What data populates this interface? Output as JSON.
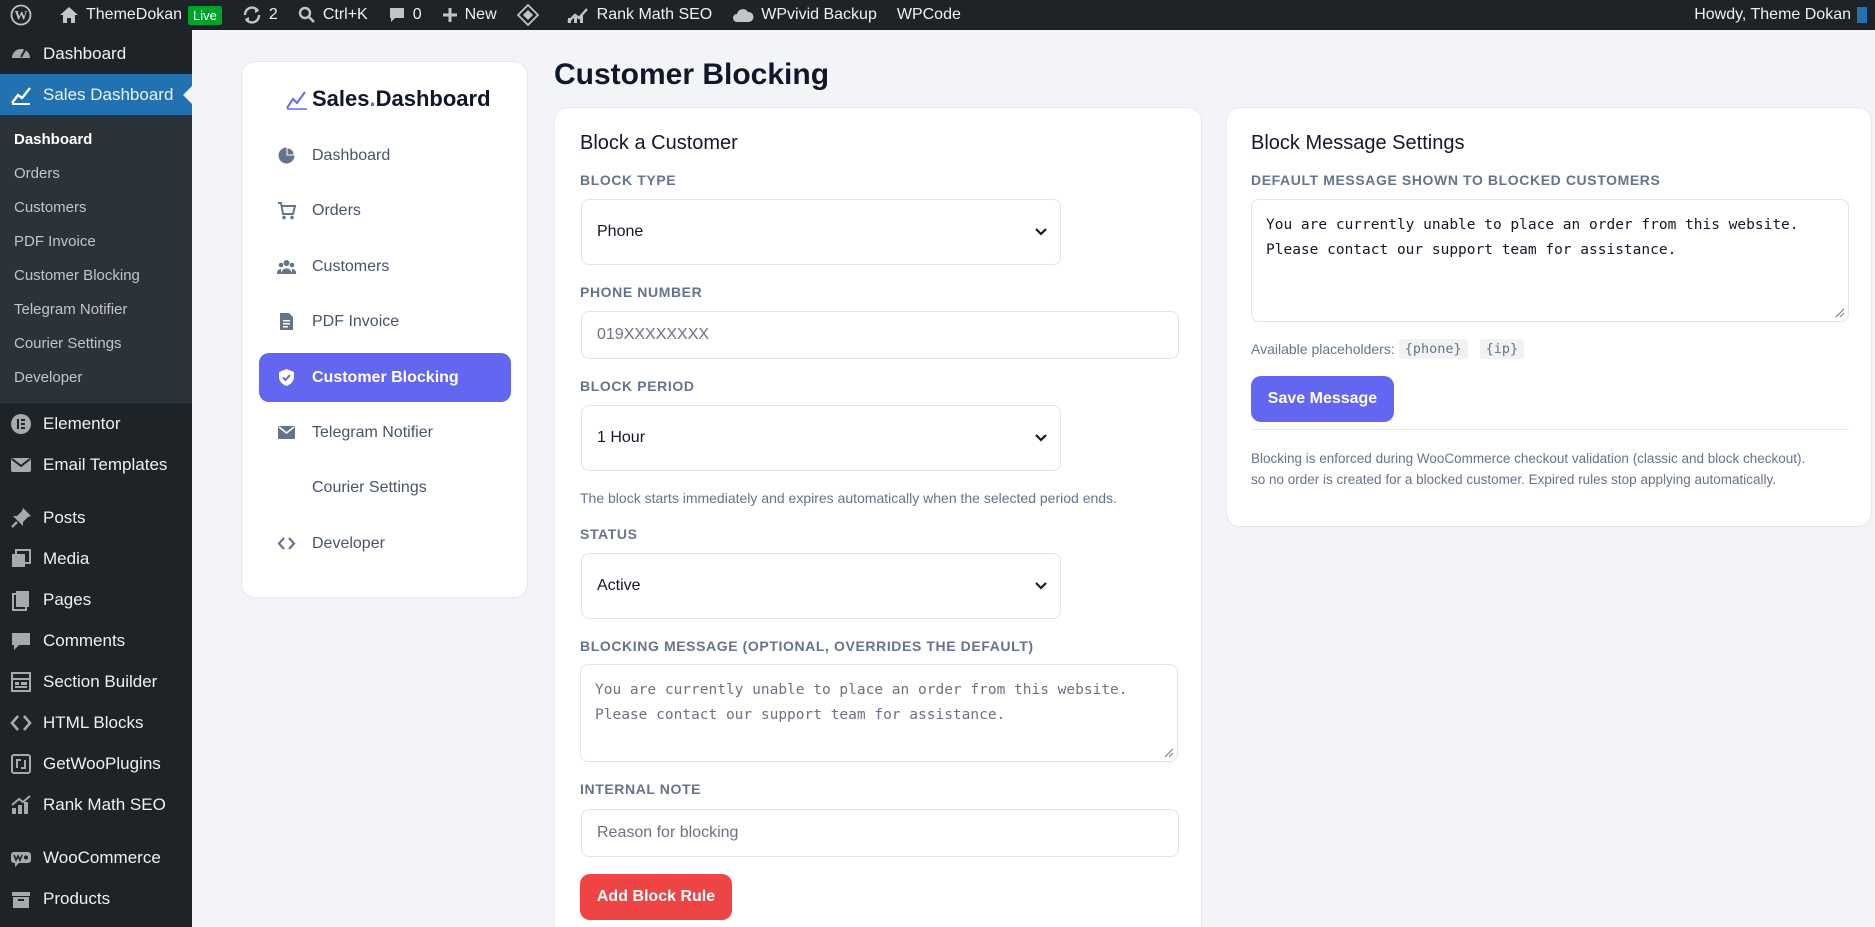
{
  "adminbar": {
    "site_name": "ThemeDokan",
    "live_badge": "Live",
    "updates_count": "2",
    "search_shortcut": "Ctrl+K",
    "comments_count": "0",
    "new_label": "New",
    "rank_math": "Rank Math SEO",
    "wpvivid": "WPvivid Backup",
    "wpcode": "WPCode",
    "howdy": "Howdy, Theme Dokan"
  },
  "wp_menu": {
    "dashboard": "Dashboard",
    "sales_dashboard": "Sales Dashboard",
    "submenu": [
      "Dashboard",
      "Orders",
      "Customers",
      "PDF Invoice",
      "Customer Blocking",
      "Telegram Notifier",
      "Courier Settings",
      "Developer"
    ],
    "elementor": "Elementor",
    "email_templates": "Email Templates",
    "posts": "Posts",
    "media": "Media",
    "pages": "Pages",
    "comments": "Comments",
    "section_builder": "Section Builder",
    "html_blocks": "HTML Blocks",
    "getwooplugins": "GetWooPlugins",
    "rank_math_seo": "Rank Math SEO",
    "woocommerce": "WooCommerce",
    "products": "Products"
  },
  "brand": {
    "part1": "Sales",
    "dot": ".",
    "part2": "Dashboard"
  },
  "plugin_nav": [
    "Dashboard",
    "Orders",
    "Customers",
    "PDF Invoice",
    "Customer Blocking",
    "Telegram Notifier",
    "Courier Settings",
    "Developer"
  ],
  "page_title": "Customer Blocking",
  "block_form": {
    "title": "Block a Customer",
    "block_type_label": "BLOCK TYPE",
    "block_type_value": "Phone",
    "phone_label": "PHONE NUMBER",
    "phone_placeholder": "019XXXXXXXX",
    "period_label": "BLOCK PERIOD",
    "period_value": "1 Hour",
    "period_help": "The block starts immediately and expires automatically when the selected period ends.",
    "status_label": "STATUS",
    "status_value": "Active",
    "message_label": "BLOCKING MESSAGE (OPTIONAL, OVERRIDES THE DEFAULT)",
    "message_placeholder_line1": "You are currently unable to place an order from this website.",
    "message_placeholder_line2": "Please contact our support team for assistance.",
    "note_label": "INTERNAL NOTE",
    "note_placeholder": "Reason for blocking",
    "submit_label": "Add Block Rule"
  },
  "message_settings": {
    "title": "Block Message Settings",
    "default_label": "DEFAULT MESSAGE SHOWN TO BLOCKED CUSTOMERS",
    "default_line1": "You are currently unable to place an order from this website.",
    "default_line2": "Please contact our support team for assistance.",
    "placeholders_label": "Available placeholders:",
    "placeholder_1": "{phone}",
    "placeholder_2": "{ip}",
    "save_label": "Save Message",
    "info_line1": "Blocking is enforced during WooCommerce checkout validation (classic and block checkout).",
    "info_line2": "so no order is created for a blocked customer. Expired rules stop applying automatically."
  },
  "colors": {
    "accent": "#6366f1",
    "danger": "#ef4444",
    "wp_blue": "#2271b1",
    "wp_dark": "#1d2327"
  }
}
